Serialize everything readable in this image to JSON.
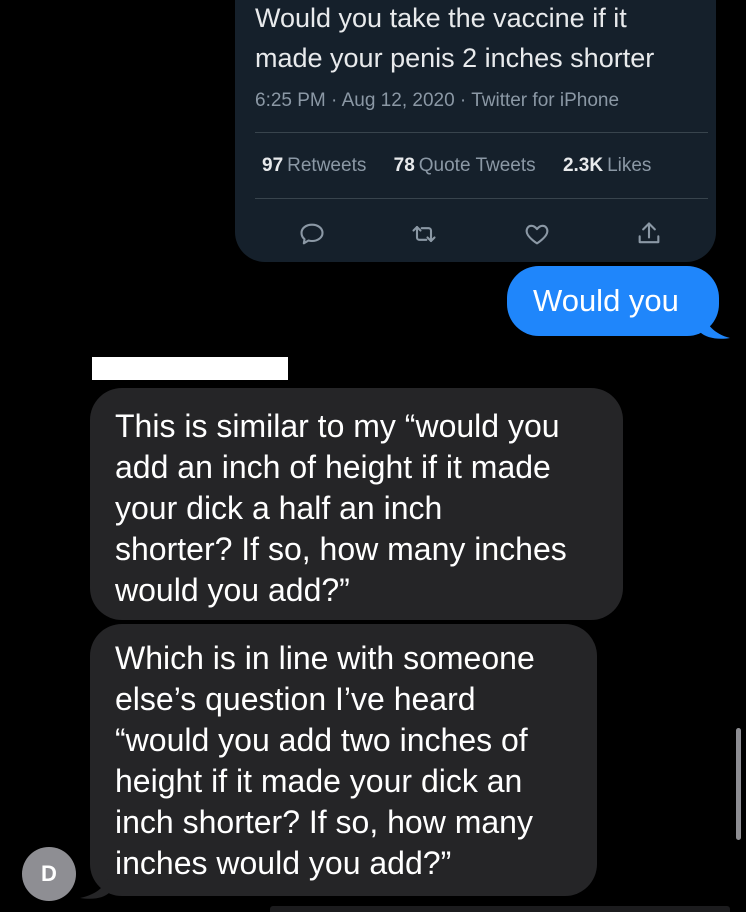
{
  "tweet": {
    "text_lines": [
      "Would you take the vaccine if it",
      "made your penis 2 inches shorter"
    ],
    "timestamp": "6:25 PM · Aug 12, 2020",
    "separator": " · ",
    "client": "Twitter for iPhone",
    "stats": {
      "retweets_count": "97",
      "retweets_label": "Retweets",
      "quotes_count": "78",
      "quotes_label": "Quote Tweets",
      "likes_count": "2.3K",
      "likes_label": "Likes"
    },
    "actions": [
      "reply-icon",
      "retweet-icon",
      "like-icon",
      "share-icon"
    ]
  },
  "messages": {
    "outgoing_1": "Would you",
    "incoming_1_lines": [
      "This is similar to my “would you",
      "add an inch of height if it made",
      "your dick a half an inch",
      "shorter? If so, how many inches",
      "would you add?”"
    ],
    "incoming_2_lines": [
      "Which is in line with someone",
      "else’s question I’ve heard",
      "“would you add two inches of",
      "height if it made your dick an",
      "inch shorter? If so, how many",
      "inches would you add?”"
    ]
  },
  "avatar": {
    "initial": "D"
  },
  "colors": {
    "background": "#000000",
    "tweet_card": "#15202b",
    "outgoing_bubble": "#1f86fb",
    "incoming_bubble": "#252527",
    "avatar": "#8e8e93"
  }
}
